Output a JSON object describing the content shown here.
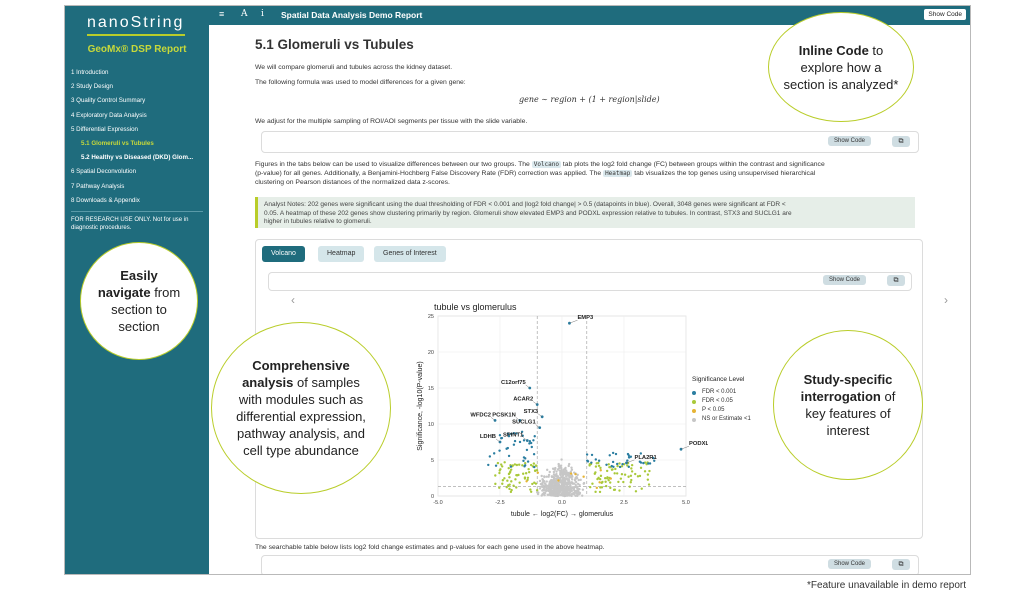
{
  "sidebar": {
    "logo": "nanoString",
    "report_title": "GeoMx® DSP Report",
    "items": [
      {
        "label": "1 Introduction",
        "sub": false,
        "active": false
      },
      {
        "label": "2 Study Design",
        "sub": false,
        "active": false
      },
      {
        "label": "3 Quality Control Summary",
        "sub": false,
        "active": false
      },
      {
        "label": "4 Exploratory Data Analysis",
        "sub": false,
        "active": false
      },
      {
        "label": "5 Differential Expression",
        "sub": false,
        "active": false
      },
      {
        "label": "5.1 Glomeruli vs Tubules",
        "sub": true,
        "active": true
      },
      {
        "label": "5.2 Healthy vs Diseased (DKD) Glom...",
        "sub": true,
        "active": false
      },
      {
        "label": "6 Spatial Deconvolution",
        "sub": false,
        "active": false
      },
      {
        "label": "7 Pathway Analysis",
        "sub": false,
        "active": false
      },
      {
        "label": "8 Downloads & Appendix",
        "sub": false,
        "active": false
      }
    ],
    "note": "FOR RESEARCH USE ONLY. Not for use in diagnostic procedures."
  },
  "topbar": {
    "menu_icon": "≡",
    "font_icon": "A",
    "info_icon": "i",
    "title": "Spatial Data Analysis Demo Report",
    "show_code": "Show Code"
  },
  "main": {
    "heading": "5.1 Glomeruli vs Tubules",
    "intro": "We will compare glomeruli and tubules across the kidney dataset.",
    "formula_intro": "The following formula was used to model differences for a given gene:",
    "formula": "gene ∼ region + (1 + region|slide)",
    "adjust": "We adjust for the multiple sampling of ROI/AOI segments per tissue with the slide variable.",
    "show_code": "Show Code",
    "copy_icon": "⧉",
    "fig_p1": "Figures in the tabs below can be used to visualize differences between our two groups. The",
    "fig_code1": "Volcano",
    "fig_p2": "tab plots the log2 fold change (FC) between groups within the contrast and significance",
    "fig_p3": "(p-value) for all genes. Additionally, a Benjamini-Hochberg False Discovery Rate (FDR) correction was applied. The",
    "fig_code2": "Heatmap",
    "fig_p4": "tab visualizes the top genes using unsupervised hierarchical",
    "fig_p5": "clustering on Pearson distances of the normalized data z-scores.",
    "notes_1": "Analyst Notes: 202 genes were significant using the dual thresholding of FDR < 0.001 and |log2 fold change| > 0.5 (datapoints in blue). Overall, 3048 genes were significant at FDR <",
    "notes_2": "0.05. A heatmap of these 202 genes show clustering primarily by region. Glomeruli show elevated EMP3 and PODXL expression relative to tubules. In contrast, STX3 and SUCLG1 are",
    "notes_3": "higher in tubules relative to glomeruli.",
    "tabs": [
      "Volcano",
      "Heatmap",
      "Genes of Interest"
    ],
    "bottom_text": "The searchable table below lists log2 fold change estimates and p-values for each gene used in the above heatmap."
  },
  "chart_data": {
    "type": "scatter",
    "title": "tubule vs glomerulus",
    "xlabel": "tubule ← log2(FC) → glomerulus",
    "ylabel": "Significance, -log10(P-value)",
    "xlim": [
      -5.0,
      5.0
    ],
    "ylim": [
      0,
      25
    ],
    "xticks": [
      "-5.0",
      "-2.5",
      "0.0",
      "2.5",
      "5.0"
    ],
    "yticks": [
      "0",
      "5",
      "10",
      "15",
      "20",
      "25"
    ],
    "legend_title": "Significance Level",
    "legend_entries": [
      {
        "label": "FDR < 0.001",
        "color": "#2b7ea1"
      },
      {
        "label": "FDR < 0.05",
        "color": "#a9c93a"
      },
      {
        "label": "P < 0.05",
        "color": "#e6b435"
      },
      {
        "label": "NS or Estimate <1",
        "color": "#c6c6c6"
      }
    ],
    "labeled_genes": [
      {
        "gene": "EMP3",
        "x": 0.3,
        "y": 24.0
      },
      {
        "gene": "C12orf75",
        "x": -1.3,
        "y": 15.0
      },
      {
        "gene": "ACAR2",
        "x": -1.0,
        "y": 12.7
      },
      {
        "gene": "STX3",
        "x": -0.8,
        "y": 11.0
      },
      {
        "gene": "PCSK1N",
        "x": -1.7,
        "y": 10.5
      },
      {
        "gene": "SUCLG1",
        "x": -0.9,
        "y": 9.5
      },
      {
        "gene": "WFDC2",
        "x": -2.7,
        "y": 10.5
      },
      {
        "gene": "LDHB",
        "x": -2.5,
        "y": 7.5
      },
      {
        "gene": "SPINT1",
        "x": -1.4,
        "y": 7.7
      },
      {
        "gene": "PODXL",
        "x": 4.8,
        "y": 6.5
      },
      {
        "gene": "PLA2R1",
        "x": 2.6,
        "y": 4.6
      }
    ]
  },
  "callouts": {
    "inline_code": {
      "bold": "Inline Code",
      "rest": "to explore how a section is analyzed*"
    },
    "navigate": {
      "bold": "Easily navigate",
      "rest": "from section to section"
    },
    "comprehensive": {
      "bold": "Comprehensive analysis",
      "rest": "of samples with modules such as differential expression, pathway analysis, and cell type abundance"
    },
    "study": {
      "bold": "Study-specific interrogation",
      "rest": "of key features of interest"
    }
  },
  "footnote": "*Feature unavailable in demo report"
}
